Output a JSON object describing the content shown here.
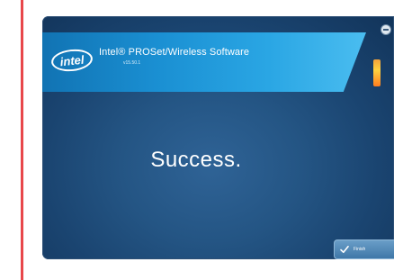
{
  "dialog": {
    "logo_text": "intel",
    "product_title": "Intel® PROSet/Wireless Software",
    "version": "v15.50.1",
    "message": "Success.",
    "finish_label": "Finish"
  },
  "colors": {
    "accent_red": "#e8474b",
    "header_blue": "#1a8fd2",
    "window_bg": "#245584"
  },
  "icons": [
    "close-icon",
    "checkmark-icon"
  ]
}
